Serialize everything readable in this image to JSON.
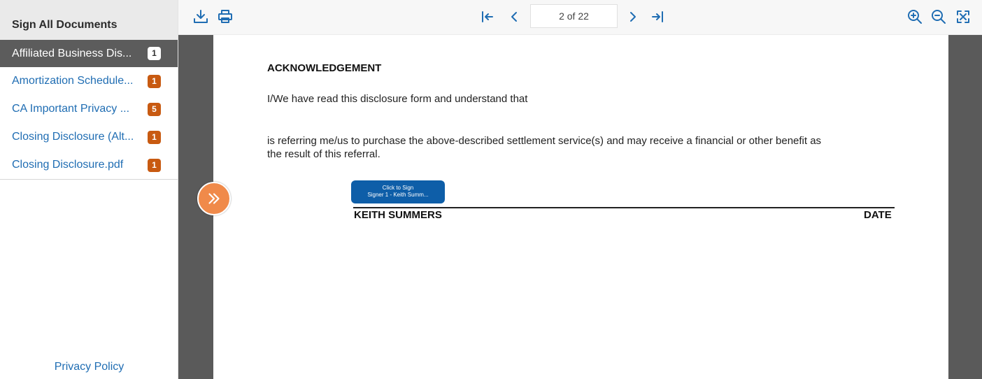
{
  "sidebar": {
    "title": "Sign All Documents",
    "documents": [
      {
        "name": "Affiliated Business Dis...",
        "count": "1",
        "active": true
      },
      {
        "name": "Amortization Schedule...",
        "count": "1",
        "active": false
      },
      {
        "name": "CA Important Privacy ...",
        "count": "5",
        "active": false
      },
      {
        "name": "Closing Disclosure (Alt...",
        "count": "1",
        "active": false
      },
      {
        "name": "Closing Disclosure.pdf",
        "count": "1",
        "active": false
      }
    ],
    "privacy_link": "Privacy Policy"
  },
  "toolbar": {
    "page_indicator": "2 of 22",
    "icons": [
      "download-icon",
      "print-icon",
      "first-page-icon",
      "prev-page-icon",
      "next-page-icon",
      "last-page-icon",
      "zoom-in-icon",
      "zoom-out-icon",
      "fit-page-icon"
    ]
  },
  "document": {
    "heading": "ACKNOWLEDGEMENT",
    "line1": "I/We have read this disclosure form and understand that",
    "line2": "is referring me/us to purchase the above-described settlement service(s) and may receive a financial or other benefit as",
    "line3": "the result of this referral.",
    "sign_button_line1": "Click to Sign",
    "sign_button_line2": "Signer 1 - Keith Summ...",
    "signer_name": "KEITH SUMMERS",
    "date_label": "DATE"
  },
  "colors": {
    "accent_blue": "#1f6db3",
    "badge_orange": "#c85a11",
    "next_button": "#f08a4a",
    "sign_button": "#0e5ea8"
  }
}
